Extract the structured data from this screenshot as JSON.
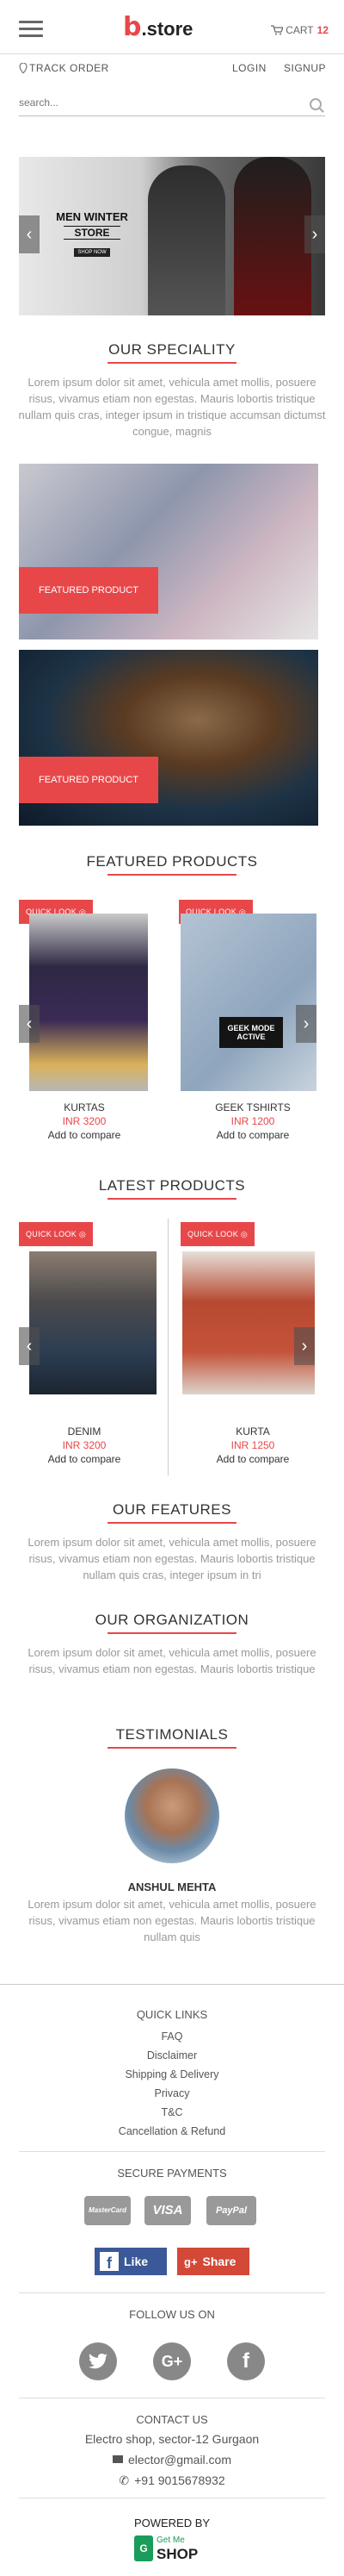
{
  "header": {
    "logo_letter": "b",
    "logo_text": ".store",
    "cart_label": "CART",
    "cart_count": "12",
    "track_order": "TRACK ORDER",
    "login": "LOGIN",
    "signup": "SIGNUP"
  },
  "search": {
    "placeholder": "search..."
  },
  "hero": {
    "line1": "MEN WINTER",
    "line2": "STORE",
    "cta": "SHOP NOW"
  },
  "speciality": {
    "title": "OUR SPECIALITY",
    "text": "Lorem ipsum dolor sit amet, vehicula amet mollis, posuere risus, vivamus etiam non egestas. Mauris lobortis tristique nullam quis cras, integer ipsum in tristique accumsan dictumst congue, magnis"
  },
  "featured_banners": [
    {
      "label": "FEATURED PRODUCT"
    },
    {
      "label": "FEATURED PRODUCT"
    }
  ],
  "featured_products": {
    "title": "FEATURED PRODUCTS",
    "quick_look": "QUICK LOOK",
    "items": [
      {
        "name": "KURTAS",
        "price": "INR 3200",
        "compare": "Add to compare"
      },
      {
        "name": "GEEK TSHIRTS",
        "price": "INR 1200",
        "compare": "Add to compare",
        "shirt_text": "GEEK MODE ACTIVE"
      }
    ]
  },
  "latest_products": {
    "title": "LATEST PRODUCTS",
    "quick_look": "QUICK LOOK",
    "items": [
      {
        "name": "DENIM",
        "price": "INR 3200",
        "compare": "Add to compare"
      },
      {
        "name": "KURTA",
        "price": "INR 1250",
        "compare": "Add to compare"
      }
    ]
  },
  "features": {
    "title": "OUR FEATURES",
    "text": "Lorem ipsum dolor sit amet, vehicula amet mollis, posuere risus, vivamus etiam non egestas. Mauris lobortis tristique nullam quis cras, integer ipsum in tri"
  },
  "organization": {
    "title": "OUR ORGANIZATION",
    "text": "Lorem ipsum dolor sit amet, vehicula amet mollis, posuere risus, vivamus etiam non egestas. Mauris lobortis tristique"
  },
  "testimonials": {
    "title": "TESTIMONIALS",
    "name": "ANSHUL MEHTA",
    "text": "Lorem ipsum dolor sit amet, vehicula amet mollis, posuere risus, vivamus etiam non egestas. Mauris lobortis tristique nullam quis"
  },
  "footer": {
    "quick_links_title": "QUICK LINKS",
    "quick_links": [
      "FAQ",
      "Disclaimer",
      "Shipping & Delivery",
      "Privacy",
      "T&C",
      "Cancellation & Refund"
    ],
    "secure_payments_title": "SECURE PAYMENTS",
    "payments": [
      "MasterCard",
      "VISA",
      "PayPal"
    ],
    "like_label": "Like",
    "share_label": "Share",
    "follow_title": "FOLLOW US ON",
    "social": [
      "twitter",
      "google-plus",
      "facebook"
    ],
    "contact_title": "CONTACT US",
    "address": "Electro shop, sector-12 Gurgaon",
    "email": "elector@gmail.com",
    "phone": "+91 9015678932",
    "powered_by": "POWERED BY",
    "powered_brand_top": "Get Me",
    "powered_brand_bottom": "SHOP"
  },
  "colors": {
    "accent": "#e8474a",
    "text": "#444444",
    "muted": "#999999"
  }
}
